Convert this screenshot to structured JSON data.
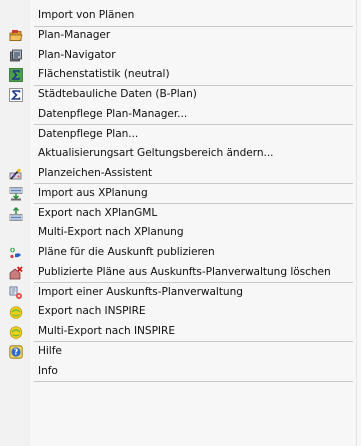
{
  "menu": {
    "items": [
      {
        "label": "Import von Plänen",
        "icon": "none"
      },
      {
        "label": "Plan-Manager",
        "icon": "folder-icon"
      },
      {
        "label": "Plan-Navigator",
        "icon": "plan-navigator-icon"
      },
      {
        "label": "Flächenstatistik (neutral)",
        "icon": "sigma-statistics-icon"
      },
      {
        "label": "Städtebauliche Daten (B-Plan)",
        "icon": "sigma-document-icon"
      },
      {
        "label": "Datenpflege Plan-Manager...",
        "icon": "none"
      },
      {
        "label": "Datenpflege Plan...",
        "icon": "none"
      },
      {
        "label": "Aktualisierungsart Geltungsbereich ändern...",
        "icon": "none"
      },
      {
        "label": "Planzeichen-Assistent",
        "icon": "magic-wand-icon"
      },
      {
        "label": "Import aus XPlanung",
        "icon": "xplan-import-icon"
      },
      {
        "label": "Export nach XPlanGML",
        "icon": "xplan-export-icon"
      },
      {
        "label": "Multi-Export nach XPlanung",
        "icon": "none"
      },
      {
        "label": "Pläne für die Auskunft publizieren",
        "icon": "publish-icon"
      },
      {
        "label": "Publizierte Pläne aus Auskunfts-Planverwaltung löschen",
        "icon": "delete-published-icon"
      },
      {
        "label": "Import einer Auskunfts-Planverwaltung",
        "icon": "import-management-icon"
      },
      {
        "label": "Export nach INSPIRE",
        "icon": "inspire-icon"
      },
      {
        "label": "Multi-Export nach INSPIRE",
        "icon": "inspire-icon"
      },
      {
        "label": "Hilfe",
        "icon": "help-icon"
      },
      {
        "label": "Info",
        "icon": "none"
      }
    ]
  }
}
